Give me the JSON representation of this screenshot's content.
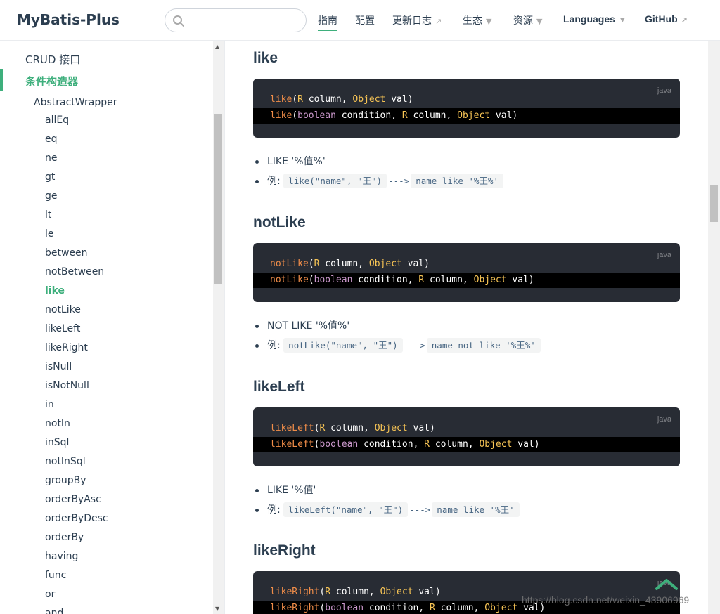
{
  "navbar": {
    "logo": "MyBatis-Plus",
    "search": {
      "placeholder": "",
      "value": ""
    },
    "items": [
      {
        "label": "指南"
      },
      {
        "label": "配置"
      },
      {
        "label": "更新日志"
      },
      {
        "label": "生态"
      },
      {
        "label": "资源"
      },
      {
        "label": "Languages"
      },
      {
        "label": "GitHub"
      }
    ],
    "accent_color": "#3eaf7c"
  },
  "sidebar": {
    "group_crud": "CRUD 接口",
    "group_active": "条件构造器",
    "subgroup": "AbstractWrapper",
    "items": [
      "allEq",
      "eq",
      "ne",
      "gt",
      "ge",
      "lt",
      "le",
      "between",
      "notBetween",
      "like",
      "notLike",
      "likeLeft",
      "likeRight",
      "isNull",
      "isNotNull",
      "in",
      "notIn",
      "inSql",
      "notInSql",
      "groupBy",
      "orderByAsc",
      "orderByDesc",
      "orderBy",
      "having",
      "func",
      "or",
      "and"
    ],
    "active_item": "like"
  },
  "sections": [
    {
      "title": "like",
      "lang": "java",
      "code": {
        "l1": {
          "fn": "like",
          "a1": "(",
          "t1": "R",
          "a2": " column, ",
          "t2": "Object",
          "a3": " val)"
        },
        "l2": {
          "fn": "like",
          "a1": "(",
          "k1": "boolean",
          "a2": " condition, ",
          "t1": "R",
          "a3": " column, ",
          "t2": "Object",
          "a4": " val)"
        }
      },
      "bullet1": "LIKE '%值%'",
      "bullet2_prefix": "例: ",
      "example": "like(\"name\", \"王\")",
      "arrow": "--->",
      "result": "name like '%王%'"
    },
    {
      "title": "notLike",
      "lang": "java",
      "code": {
        "l1": {
          "fn": "notLike",
          "a1": "(",
          "t1": "R",
          "a2": " column, ",
          "t2": "Object",
          "a3": " val)"
        },
        "l2": {
          "fn": "notLike",
          "a1": "(",
          "k1": "boolean",
          "a2": " condition, ",
          "t1": "R",
          "a3": " column, ",
          "t2": "Object",
          "a4": " val)"
        }
      },
      "bullet1": "NOT LIKE '%值%'",
      "bullet2_prefix": "例: ",
      "example": "notLike(\"name\", \"王\")",
      "arrow": "--->",
      "result": "name not like '%王%'"
    },
    {
      "title": "likeLeft",
      "lang": "java",
      "code": {
        "l1": {
          "fn": "likeLeft",
          "a1": "(",
          "t1": "R",
          "a2": " column, ",
          "t2": "Object",
          "a3": " val)"
        },
        "l2": {
          "fn": "likeLeft",
          "a1": "(",
          "k1": "boolean",
          "a2": " condition, ",
          "t1": "R",
          "a3": " column, ",
          "t2": "Object",
          "a4": " val)"
        }
      },
      "bullet1": "LIKE '%值'",
      "bullet2_prefix": "例: ",
      "example": "likeLeft(\"name\", \"王\")",
      "arrow": "--->",
      "result": "name like '%王'"
    },
    {
      "title": "likeRight",
      "lang": "java",
      "code": {
        "l1": {
          "fn": "likeRight",
          "a1": "(",
          "t1": "R",
          "a2": " column, ",
          "t2": "Object",
          "a3": " val)"
        },
        "l2": {
          "fn": "likeRight",
          "a1": "(",
          "k1": "boolean",
          "a2": " condition, ",
          "t1": "R",
          "a3": " column, ",
          "t2": "Object",
          "a4": " val)"
        }
      }
    }
  ],
  "watermark": "https://blog.csdn.net/weixin_43906969"
}
